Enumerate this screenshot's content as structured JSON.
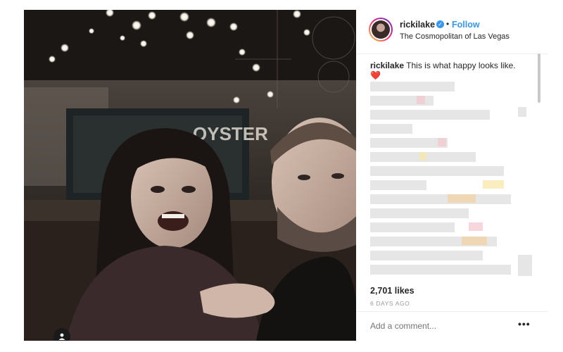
{
  "post": {
    "username": "rickilake",
    "separator": "•",
    "follow_label": "Follow",
    "location": "The Cosmopolitan of Las Vegas",
    "caption_user": "rickilake",
    "caption_text": "This is what happy looks like.",
    "caption_emoji": "❤️",
    "likes": "2,701 likes",
    "date": "6 DAYS AGO",
    "comment_placeholder": "Add a comment...",
    "more_icon": "•••"
  },
  "icons": {
    "verified": "verified-badge-icon",
    "user_tag": "user-tag-icon",
    "more": "more-options-icon"
  },
  "colors": {
    "accent": "#3897f0",
    "text": "#262626",
    "muted": "#999999",
    "heart": "#e0243b"
  }
}
